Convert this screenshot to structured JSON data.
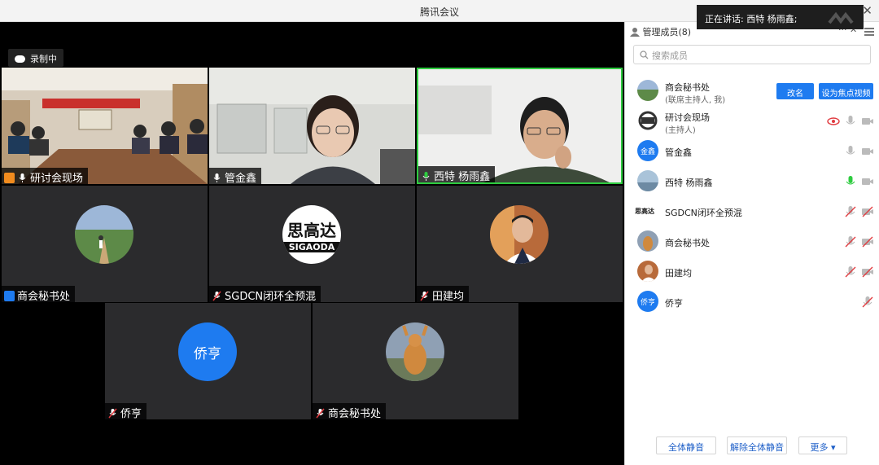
{
  "window": {
    "title": "腾讯会议",
    "speaking_text": "正在讲话: 西特 杨雨鑫;",
    "close_glyph": "✕"
  },
  "stage": {
    "recording_label": "录制中",
    "tiles": [
      {
        "name": "研讨会现场"
      },
      {
        "name": "管金鑫"
      },
      {
        "name": "西特 杨雨鑫"
      },
      {
        "name": "商会秘书处"
      },
      {
        "name": "SGDCN闭环全预混"
      },
      {
        "name": "田建均"
      },
      {
        "name": "侨亨",
        "avatar_text": "侨亨"
      },
      {
        "name": "商会秘书处"
      }
    ],
    "sgaoda_logo_line1": "思高达",
    "sgaoda_logo_line2": "SIGAODA"
  },
  "panel": {
    "header": "管理成员(8)",
    "more_glyph": "···",
    "close_glyph": "✕",
    "search_placeholder": "搜索成员",
    "members": [
      {
        "name": "商会秘书处",
        "sub": "(联席主持人, 我)",
        "rename": "改名",
        "focus": "设为焦点视频"
      },
      {
        "name": "研讨会现场",
        "sub": "(主持人)"
      },
      {
        "name": "管金鑫",
        "avatar_text": "金鑫"
      },
      {
        "name": "西特 杨雨鑫"
      },
      {
        "name": "SGDCN闭环全预混",
        "avatar_text": "思高达"
      },
      {
        "name": "商会秘书处"
      },
      {
        "name": "田建均"
      },
      {
        "name": "侨亨",
        "avatar_text": "侨亨"
      }
    ],
    "buttons": {
      "mute_all": "全体静音",
      "unmute_all": "解除全体静音",
      "more": "更多 ▾"
    }
  },
  "colors": {
    "accent": "#1e7bf0",
    "host_orange": "#f28c1e",
    "active_mic": "#2ecc40",
    "muted_red": "#e0393e"
  }
}
